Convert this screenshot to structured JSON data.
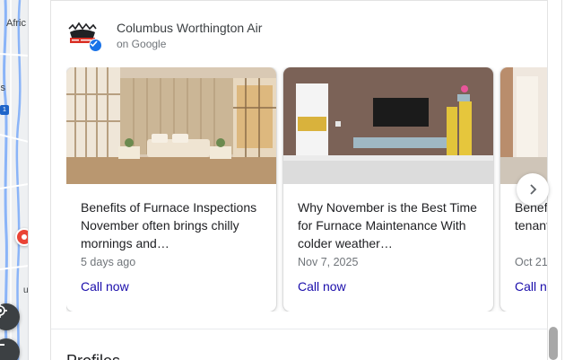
{
  "map": {
    "label_africa": "Afric",
    "label_is": "is",
    "label_u": "u",
    "route_shield": "1"
  },
  "business": {
    "name": "Columbus Worthington Air",
    "source": "on Google",
    "logo_icon": "company-logo-icon",
    "verified_icon": "verified-check-icon",
    "accent_color": "#1a73e8"
  },
  "posts": [
    {
      "title": "Benefits of Furnace Inspections November often brings chilly mornings and…",
      "date": "5 days ago",
      "cta": "Call now"
    },
    {
      "title": "Why November is the Best Time for Furnace Maintenance With colder weather…",
      "date": "Nov 7, 2025",
      "cta": "Call now"
    },
    {
      "title": "Benefits of Fall Tune-ups and tenants",
      "date": "Oct 21",
      "cta": "Call now"
    }
  ],
  "carousel": {
    "next_icon": "chevron-right-icon"
  },
  "sections": {
    "profiles_heading": "Profiles"
  },
  "colors": {
    "link": "#1a0dab",
    "muted": "#70757a"
  }
}
